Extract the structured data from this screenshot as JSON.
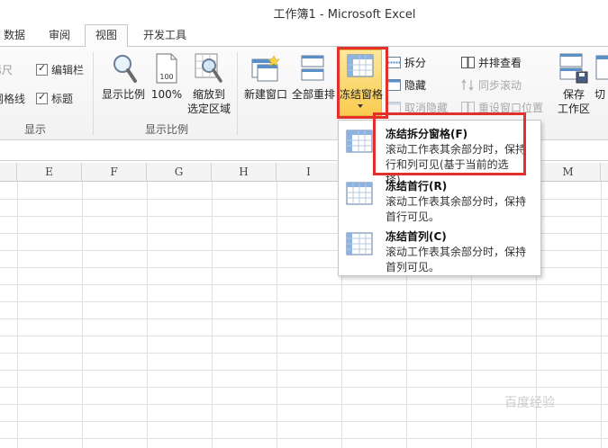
{
  "window": {
    "title": "工作簿1  -  Microsoft Excel"
  },
  "tabs": [
    {
      "label": "数据"
    },
    {
      "label": "审阅"
    },
    {
      "label": "视图"
    },
    {
      "label": "开发工具"
    }
  ],
  "ribbon": {
    "show_group": {
      "label": "显示",
      "ruler": "标尺",
      "gridlines": "网格线",
      "formula_bar": "编辑栏",
      "headings": "标题"
    },
    "zoom_group": {
      "label": "显示比例",
      "zoom": "显示比例",
      "zoom100": "100%",
      "zoom_to_selection_l1": "缩放到",
      "zoom_to_selection_l2": "选定区域",
      "icon_100": "100"
    },
    "window_group": {
      "new_window": "新建窗口",
      "arrange_all": "全部重排",
      "freeze_panes": "冻结窗格",
      "split": "拆分",
      "hide": "隐藏",
      "unhide": "取消隐藏",
      "view_side_by_side": "并排查看",
      "sync_scrolling": "同步滚动",
      "reset_window_position": "重设窗口位置",
      "save_workspace_l1": "保存",
      "save_workspace_l2": "工作区",
      "switch_windows": "切"
    }
  },
  "columns": [
    "E",
    "F",
    "G",
    "H",
    "I",
    "M"
  ],
  "freeze_menu": {
    "items": [
      {
        "title": "冻结拆分窗格(F)",
        "desc": "滚动工作表其余部分时，保持行和列可见(基于当前的选择)。"
      },
      {
        "title": "冻结首行(R)",
        "desc": "滚动工作表其余部分时，保持首行可见。"
      },
      {
        "title": "冻结首列(C)",
        "desc": "滚动工作表其余部分时，保持首列可见。"
      }
    ]
  },
  "watermark": "百度经验",
  "colors": {
    "highlight_red": "#e2312b",
    "freeze_button_yellow": "#f9cb50"
  }
}
